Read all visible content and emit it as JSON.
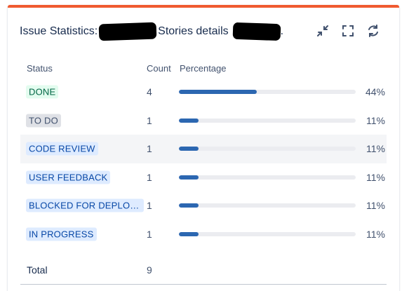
{
  "header": {
    "title_part1": "Issue Statistics:",
    "title_part2": "Stories details",
    "title_suffix": ".",
    "icons": [
      "minimize-icon",
      "fullscreen-icon",
      "refresh-icon"
    ]
  },
  "columns": {
    "status": "Status",
    "count": "Count",
    "percentage": "Percentage"
  },
  "colors": {
    "accent_top": "#f05a30",
    "bar": "#2c67b1",
    "green_lozenge": "#e3fcef",
    "blue_lozenge": "#deebff",
    "grey_lozenge": "#dfe1e6"
  },
  "rows": [
    {
      "status": "DONE",
      "status_style": "green",
      "count": "4",
      "percent_label": "44%",
      "percent": 44
    },
    {
      "status": "TO DO",
      "status_style": "grey",
      "count": "1",
      "percent_label": "11%",
      "percent": 11
    },
    {
      "status": "CODE REVIEW",
      "status_style": "blue",
      "count": "1",
      "percent_label": "11%",
      "percent": 11
    },
    {
      "status": "USER FEEDBACK",
      "status_style": "blue",
      "count": "1",
      "percent_label": "11%",
      "percent": 11
    },
    {
      "status": "BLOCKED FOR DEPLOYMENT",
      "status_style": "blue",
      "count": "1",
      "percent_label": "11%",
      "percent": 11
    },
    {
      "status": "IN PROGRESS",
      "status_style": "blue",
      "count": "1",
      "percent_label": "11%",
      "percent": 11
    }
  ],
  "total": {
    "label": "Total",
    "count": "9"
  }
}
